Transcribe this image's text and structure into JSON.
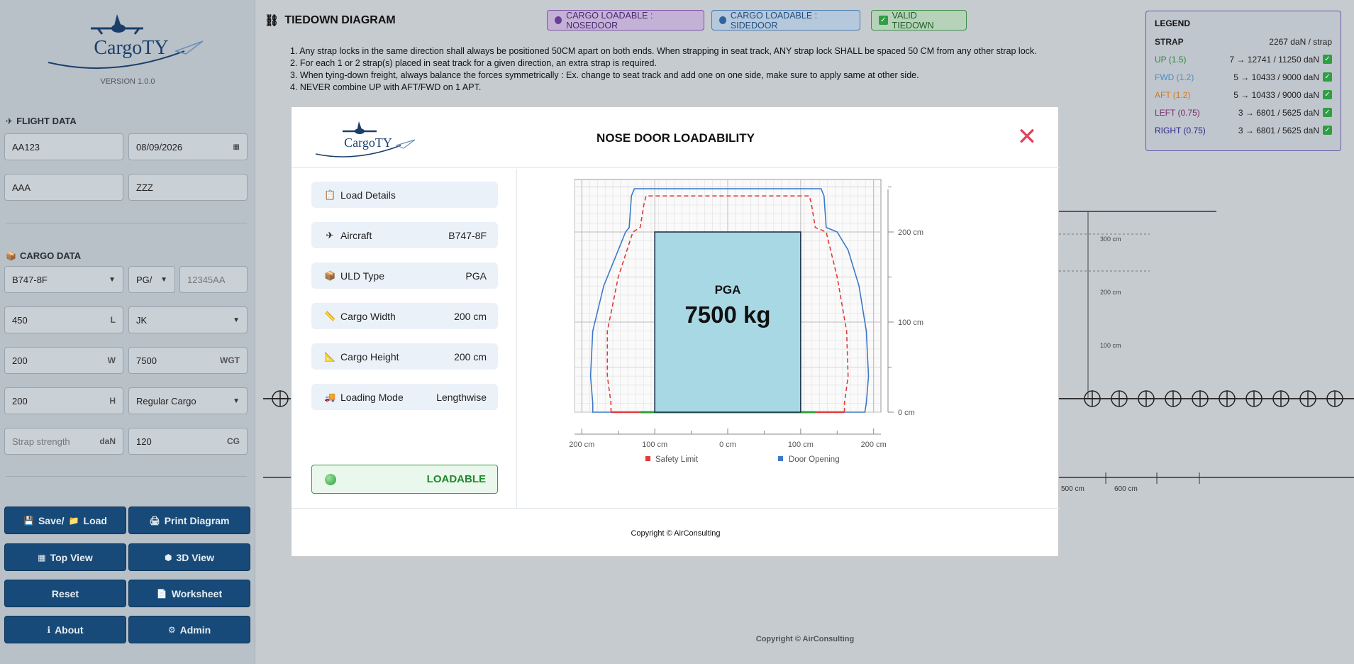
{
  "app": {
    "logo_text": "CargoTY",
    "version": "VERSION 1.0.0"
  },
  "flight_data": {
    "title": "FLIGHT DATA",
    "flight_number": "AA123",
    "date": "08/09/2026",
    "origin": "AAA",
    "destination": "ZZZ"
  },
  "cargo_data": {
    "title": "CARGO DATA",
    "aircraft": "B747-8F",
    "uld": "PG/",
    "uld_number_placeholder": "12345AA",
    "length": "450",
    "length_unit": "L",
    "contour": "JK",
    "width": "200",
    "width_unit": "W",
    "weight": "7500",
    "weight_unit": "WGT",
    "height": "200",
    "height_unit": "H",
    "cargo_type": "Regular Cargo",
    "strap_placeholder": "Strap strength",
    "strap_unit": "daN",
    "cg": "120",
    "cg_unit": "CG"
  },
  "buttons": {
    "save_load": "Save/",
    "save_load_2": "Load",
    "print": "Print Diagram",
    "top_view": "Top View",
    "view_3d": "3D View",
    "reset": "Reset",
    "worksheet": "Worksheet",
    "about": "About",
    "admin": "Admin"
  },
  "tiedown": {
    "title": "TIEDOWN DIAGRAM",
    "pills": {
      "nosedoor": "CARGO LOADABLE : NOSEDOOR",
      "sidedoor": "CARGO LOADABLE : SIDEDOOR",
      "valid": "VALID TIEDOWN"
    },
    "rules": [
      "1. Any strap locks in the same direction shall always be positioned 50CM apart on both ends. When strapping in seat track, ANY strap lock SHALL be spaced 50 CM from any other strap lock.",
      "2. For each 1 or 2 strap(s) placed in seat track for a given direction, an extra strap is required.",
      "3. When tying-down freight, always balance the forces symmetrically : Ex. change to seat track and add one on one side, make sure to apply same at other side.",
      "4. NEVER combine UP with AFT/FWD on 1 APT."
    ],
    "copyright": "Copyright © AirConsulting",
    "bg_labels": [
      "300 cm",
      "200 cm",
      "100 cm",
      "500 cm",
      "600 cm"
    ]
  },
  "legend": {
    "title": "LEGEND",
    "strap_label": "STRAP",
    "strap_value": "2267 daN / strap",
    "rows": [
      {
        "label": "UP (1.5)",
        "value": "7 → 12741 / 11250 daN",
        "color": "#2e8b3a"
      },
      {
        "label": "FWD (1.2)",
        "value": "5 → 10433 / 9000 daN",
        "color": "#4a8fc0"
      },
      {
        "label": "AFT (1.2)",
        "value": "5 → 10433 / 9000 daN",
        "color": "#d07a1f"
      },
      {
        "label": "LEFT (0.75)",
        "value": "3 → 6801 / 5625 daN",
        "color": "#7a2d6e"
      },
      {
        "label": "RIGHT (0.75)",
        "value": "3 → 6801 / 5625 daN",
        "color": "#2a2a8a"
      }
    ]
  },
  "modal": {
    "title": "NOSE DOOR LOADABILITY",
    "details": [
      {
        "key": "Load Details",
        "value": "",
        "icon": "clipboard-icon",
        "glyph": "📋"
      },
      {
        "key": "Aircraft",
        "value": "B747-8F",
        "icon": "airplane-icon",
        "glyph": "✈"
      },
      {
        "key": "ULD Type",
        "value": "PGA",
        "icon": "package-icon",
        "glyph": "📦"
      },
      {
        "key": "Cargo Width",
        "value": "200 cm",
        "icon": "ruler-icon",
        "glyph": "📏"
      },
      {
        "key": "Cargo Height",
        "value": "200 cm",
        "icon": "triangle-ruler-icon",
        "glyph": "📐"
      },
      {
        "key": "Loading Mode",
        "value": "Lengthwise",
        "icon": "truck-icon",
        "glyph": "🚚"
      }
    ],
    "status": "LOADABLE",
    "copyright": "Copyright © AirConsulting",
    "chart": {
      "cargo_label": "PGA",
      "weight_label": "7500 kg",
      "y_ticks": [
        "0 cm",
        "100 cm",
        "200 cm"
      ],
      "x_ticks": [
        "200 cm",
        "100 cm",
        "0 cm",
        "100 cm",
        "200 cm"
      ],
      "legend_safety": "Safety Limit",
      "legend_door": "Door Opening",
      "cargo_width_cm": 200,
      "cargo_height_cm": 200,
      "colors": {
        "door": "#3d78c9",
        "safety": "#e23a3a",
        "cargo": "#a9d8e5",
        "floor_ok": "#2aa533"
      }
    }
  }
}
